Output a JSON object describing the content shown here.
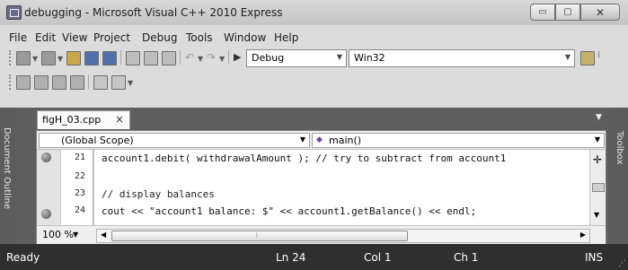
{
  "window": {
    "title": "debugging - Microsoft Visual C++ 2010 Express",
    "minimize_glyph": "▭",
    "maximize_glyph": "▢",
    "close_glyph": "✕"
  },
  "menu": [
    "File",
    "Edit",
    "View",
    "Project",
    "Debug",
    "Tools",
    "Window",
    "Help"
  ],
  "toolbar": {
    "solution_config": "Debug",
    "platform": "Win32"
  },
  "side_panels": {
    "left": "Document Outline",
    "right": "Toolbox"
  },
  "document_tab": {
    "name": "figH_03.cpp",
    "close_glyph": "×"
  },
  "navbar": {
    "scope": "(Global Scope)",
    "function": "main()"
  },
  "code": {
    "lines": [
      {
        "number": "21",
        "breakpoint": true,
        "text": "account1.debit( withdrawalAmount ); // try to subtract from account1"
      },
      {
        "number": "22",
        "breakpoint": false,
        "text": ""
      },
      {
        "number": "23",
        "breakpoint": false,
        "text": "// display balances"
      },
      {
        "number": "24",
        "breakpoint": true,
        "text": "cout << \"account1 balance: $\" << account1.getBalance() << endl;"
      }
    ]
  },
  "zoom": "100 %",
  "status": {
    "ready": "Ready",
    "line": "Ln 24",
    "col": "Col 1",
    "ch": "Ch 1",
    "mode": "INS"
  },
  "colors": {
    "status_bar": "#2f2f2f",
    "side_panel": "#5c5c5c",
    "editor_bg": "#ffffff"
  }
}
